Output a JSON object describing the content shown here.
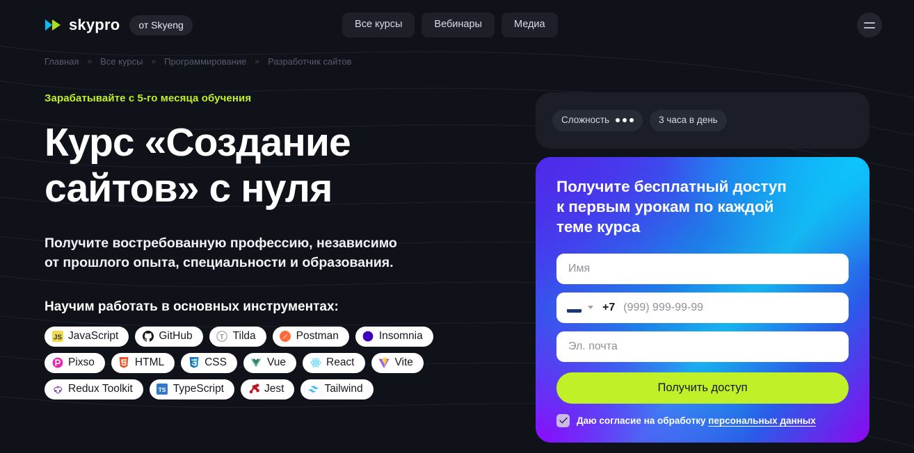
{
  "colors": {
    "page_bg": "#0f1219",
    "accent_lime": "#c0f028",
    "card_bg": "#1b1e26",
    "gradient_start": "#8d07f0",
    "gradient_end": "#16b4ee"
  },
  "header": {
    "logo_word": "skypro",
    "logo_icon": "skypro-play-mark",
    "badge": "от Skyeng",
    "nav": [
      {
        "label": "Все курсы",
        "name": "nav-all-courses"
      },
      {
        "label": "Вебинары",
        "name": "nav-webinars"
      },
      {
        "label": "Медиа",
        "name": "nav-media"
      }
    ],
    "menu_icon": "hamburger-icon"
  },
  "breadcrumb": {
    "separator": "»",
    "items": [
      "Главная",
      "Все курсы",
      "Программирование",
      "Разработчик сайтов"
    ]
  },
  "hero": {
    "eyebrow": "Зарабатывайте с 5-го месяца обучения",
    "title_line1": "Курс «Создание",
    "title_line2": "сайтов» с нуля",
    "subtitle_line1": "Получите востребованную профессию, независимо",
    "subtitle_line2": "от прошлого опыта, специальности и образования.",
    "tools_heading": "Научим работать в основных инструментах:"
  },
  "tools": {
    "rows": [
      [
        {
          "label": "JavaScript",
          "icon": "javascript-icon"
        },
        {
          "label": "GitHub",
          "icon": "github-icon"
        },
        {
          "label": "Tilda",
          "icon": "tilda-icon"
        },
        {
          "label": "Postman",
          "icon": "postman-icon"
        },
        {
          "label": "Insomnia",
          "icon": "insomnia-icon"
        }
      ],
      [
        {
          "label": "Pixso",
          "icon": "pixso-icon"
        },
        {
          "label": "HTML",
          "icon": "html5-icon"
        },
        {
          "label": "CSS",
          "icon": "css3-icon"
        },
        {
          "label": "Vue",
          "icon": "vue-icon"
        },
        {
          "label": "React",
          "icon": "react-icon"
        },
        {
          "label": "Vite",
          "icon": "vite-icon"
        }
      ],
      [
        {
          "label": "Redux Toolkit",
          "icon": "redux-icon"
        },
        {
          "label": "TypeScript",
          "icon": "typescript-icon"
        },
        {
          "label": "Jest",
          "icon": "jest-icon"
        },
        {
          "label": "Tailwind",
          "icon": "tailwind-icon"
        }
      ]
    ]
  },
  "meta": {
    "difficulty_label": "Сложность",
    "difficulty_dots": 3,
    "time_label": "3 часа в день"
  },
  "form": {
    "title_line1": "Получите бесплатный доступ",
    "title_line2": "к первым урокам по каждой",
    "title_line3": "теме курса",
    "name_placeholder": "Имя",
    "name_value": "",
    "phone_country_icon": "russia-flag-icon",
    "phone_code": "+7",
    "phone_placeholder": "(999) 999-99-99",
    "phone_value": "",
    "email_placeholder": "Эл. почта",
    "email_value": "",
    "submit_label": "Получить доступ",
    "consent_text": "Даю согласие на обработку",
    "consent_link": "персональных данных",
    "consent_checked": true
  }
}
